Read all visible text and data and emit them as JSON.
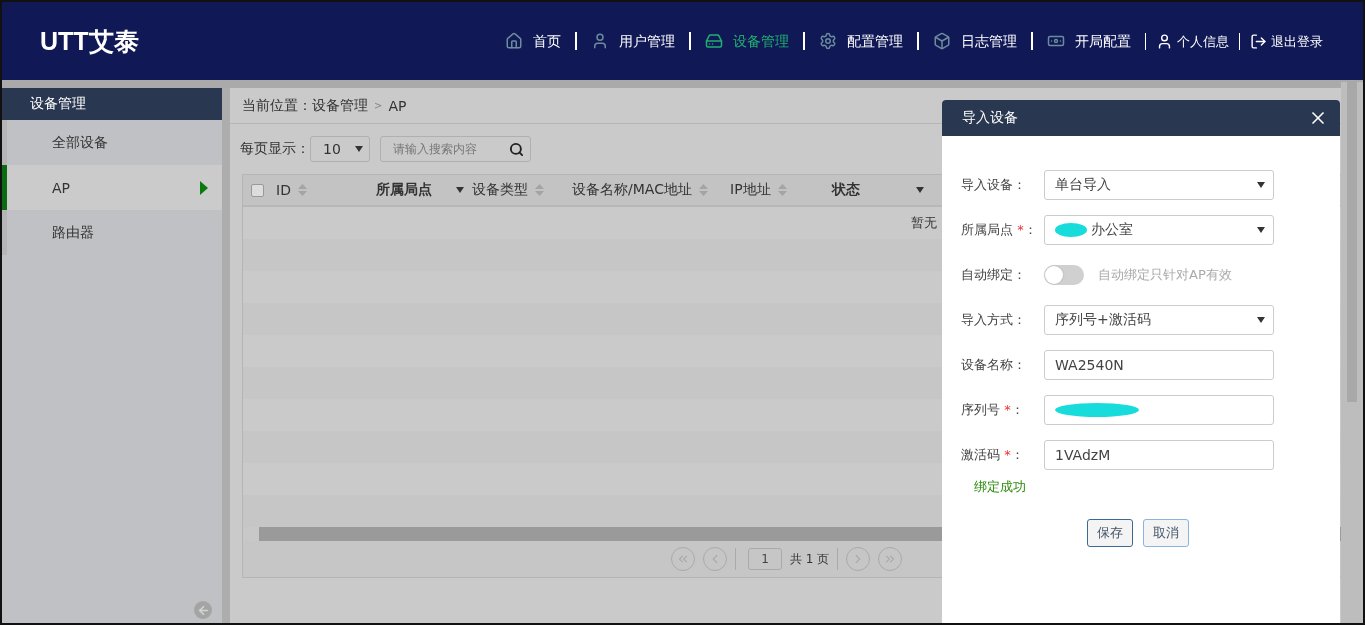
{
  "header": {
    "logo": "UTT艾泰",
    "nav": [
      {
        "label": "首页",
        "selected": false
      },
      {
        "label": "用户管理",
        "selected": false
      },
      {
        "label": "设备管理",
        "selected": true
      },
      {
        "label": "配置管理",
        "selected": false
      },
      {
        "label": "日志管理",
        "selected": false
      },
      {
        "label": "开局配置",
        "selected": false
      }
    ],
    "user_links": [
      {
        "label": "个人信息"
      },
      {
        "label": "退出登录"
      }
    ]
  },
  "sidebar": {
    "title": "设备管理",
    "items": [
      {
        "label": "全部设备",
        "selected": false
      },
      {
        "label": "AP",
        "selected": true
      },
      {
        "label": "路由器",
        "selected": false
      }
    ]
  },
  "breadcrumb": {
    "path": "当前位置：设备管理",
    "separator": ">",
    "current": "AP"
  },
  "toolbar": {
    "page_size_label": "每页显示：",
    "page_size": "10",
    "search_placeholder": "请输入搜索内容"
  },
  "table": {
    "select_all_checked": false,
    "columns": [
      {
        "label": "ID",
        "kind": "sort"
      },
      {
        "label": "所属局点",
        "kind": "filter"
      },
      {
        "label": "设备类型",
        "kind": "sort"
      },
      {
        "label": "设备名称/MAC地址",
        "kind": "sort"
      },
      {
        "label": "IP地址",
        "kind": "sort"
      },
      {
        "label": "状态",
        "kind": "filter"
      }
    ],
    "empty_text": "暂无"
  },
  "pagination": {
    "page": "1",
    "total": "共 1 页"
  },
  "dialog": {
    "title": "导入设备",
    "fields": [
      {
        "kind": "select",
        "label": "导入设备：",
        "value": "单台导入"
      },
      {
        "kind": "select",
        "label": "所属局点",
        "required_mark": "*",
        "suffix": "：",
        "value": "办公室",
        "redacted": true
      },
      {
        "kind": "toggle",
        "label": "自动绑定：",
        "on": false,
        "hint": "自动绑定只针对AP有效"
      },
      {
        "kind": "select",
        "label": "导入方式：",
        "value": "序列号+激活码"
      },
      {
        "kind": "input",
        "label": "设备名称：",
        "value": "WA2540N"
      },
      {
        "kind": "input",
        "label": "序列号",
        "required_mark": "*",
        "suffix": "：",
        "redacted": true
      },
      {
        "kind": "input",
        "label": "激活码",
        "required_mark": "*",
        "suffix": "：",
        "value": "1VAdzM"
      }
    ],
    "status": "绑定成功",
    "buttons": [
      {
        "label": "保存",
        "primary": true
      },
      {
        "label": "取消",
        "primary": false
      }
    ]
  }
}
